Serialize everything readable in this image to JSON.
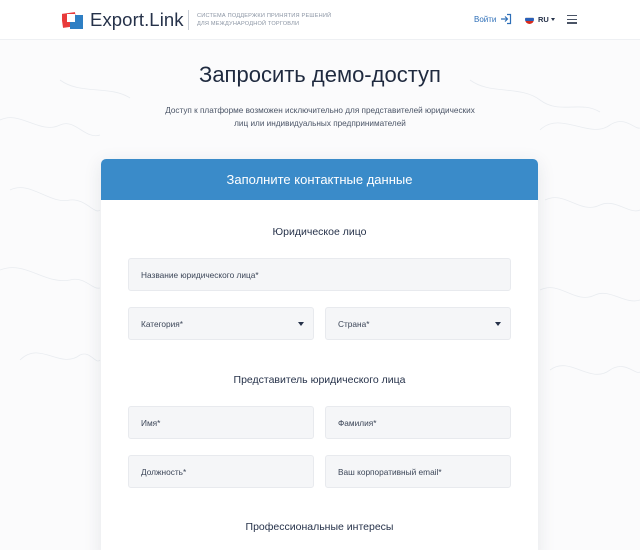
{
  "header": {
    "brand": "Export.Link",
    "tagline": "Система поддержки принятия решений для международной торговли",
    "login_label": "Войти",
    "lang_label": "RU",
    "colors": {
      "logo_red": "#e83a3a",
      "logo_blue": "#2e7fc4",
      "link_blue": "#2e6fb8"
    },
    "icons": {
      "login": "login-arrow-icon",
      "menu": "hamburger-menu-icon",
      "flag": "russia-flag-icon"
    }
  },
  "page": {
    "title": "Запросить демо-доступ",
    "subtitle": "Доступ к платформе возможен исключительно для представителей юридических лиц или индивидуальных предпринимателей"
  },
  "form": {
    "header": "Заполните контактные данные",
    "header_color": "#3a8bc9",
    "sections": {
      "legal_entity": "Юридическое лицо",
      "representative": "Представитель юридического лица",
      "interests": "Профессиональные интересы"
    },
    "fields": {
      "company_name": "Название юридического лица*",
      "category": "Категория*",
      "country": "Страна*",
      "first_name": "Имя*",
      "last_name": "Фамилия*",
      "position": "Должность*",
      "email": "Ваш корпоративный email*"
    }
  }
}
